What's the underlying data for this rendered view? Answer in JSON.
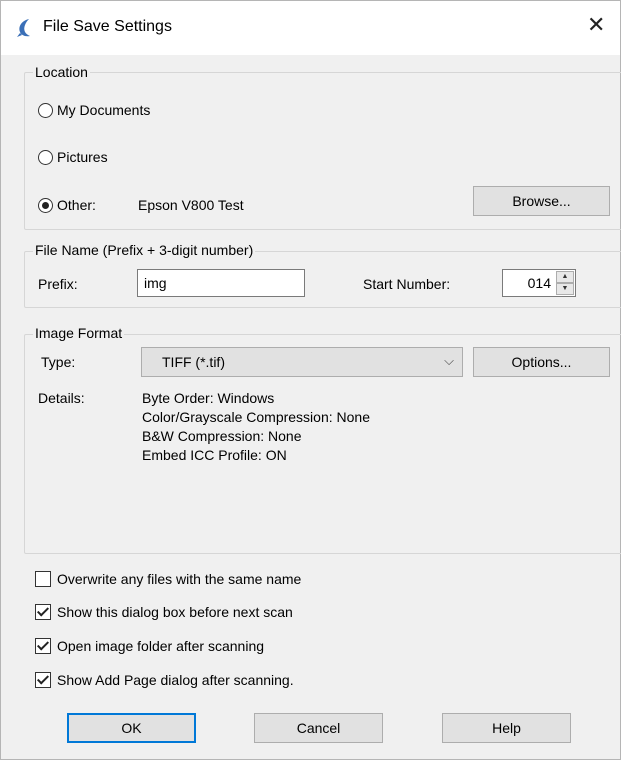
{
  "window": {
    "title": "File Save Settings",
    "close_glyph": "✕",
    "app_icon": "epson-scan-icon"
  },
  "location": {
    "legend": "Location",
    "options": [
      {
        "label": "My Documents",
        "checked": false
      },
      {
        "label": "Pictures",
        "checked": false
      },
      {
        "label": "Other:",
        "checked": true
      }
    ],
    "other_value": "Epson V800 Test",
    "browse_label": "Browse..."
  },
  "file_name": {
    "legend": "File Name (Prefix + 3-digit number)",
    "prefix_label": "Prefix:",
    "prefix_value": "img",
    "start_label": "Start Number:",
    "start_value": "014"
  },
  "image_format": {
    "legend": "Image Format",
    "type_label": "Type:",
    "type_value": "TIFF (*.tif)",
    "options_label": "Options...",
    "details_label": "Details:",
    "details": [
      "Byte Order: Windows",
      "Color/Grayscale Compression: None",
      "B&W Compression: None",
      "Embed ICC Profile: ON"
    ]
  },
  "checks": [
    {
      "label": "Overwrite any files with the same name",
      "checked": false
    },
    {
      "label": "Show this dialog box before next scan",
      "checked": true
    },
    {
      "label": "Open image folder after scanning",
      "checked": true
    },
    {
      "label": "Show Add Page dialog after scanning.",
      "checked": true
    }
  ],
  "buttons": {
    "ok": "OK",
    "cancel": "Cancel",
    "help": "Help"
  },
  "colors": {
    "dialog_bg": "#f0f0f0",
    "title_bg": "#ffffff",
    "focus_border": "#0078d7"
  }
}
